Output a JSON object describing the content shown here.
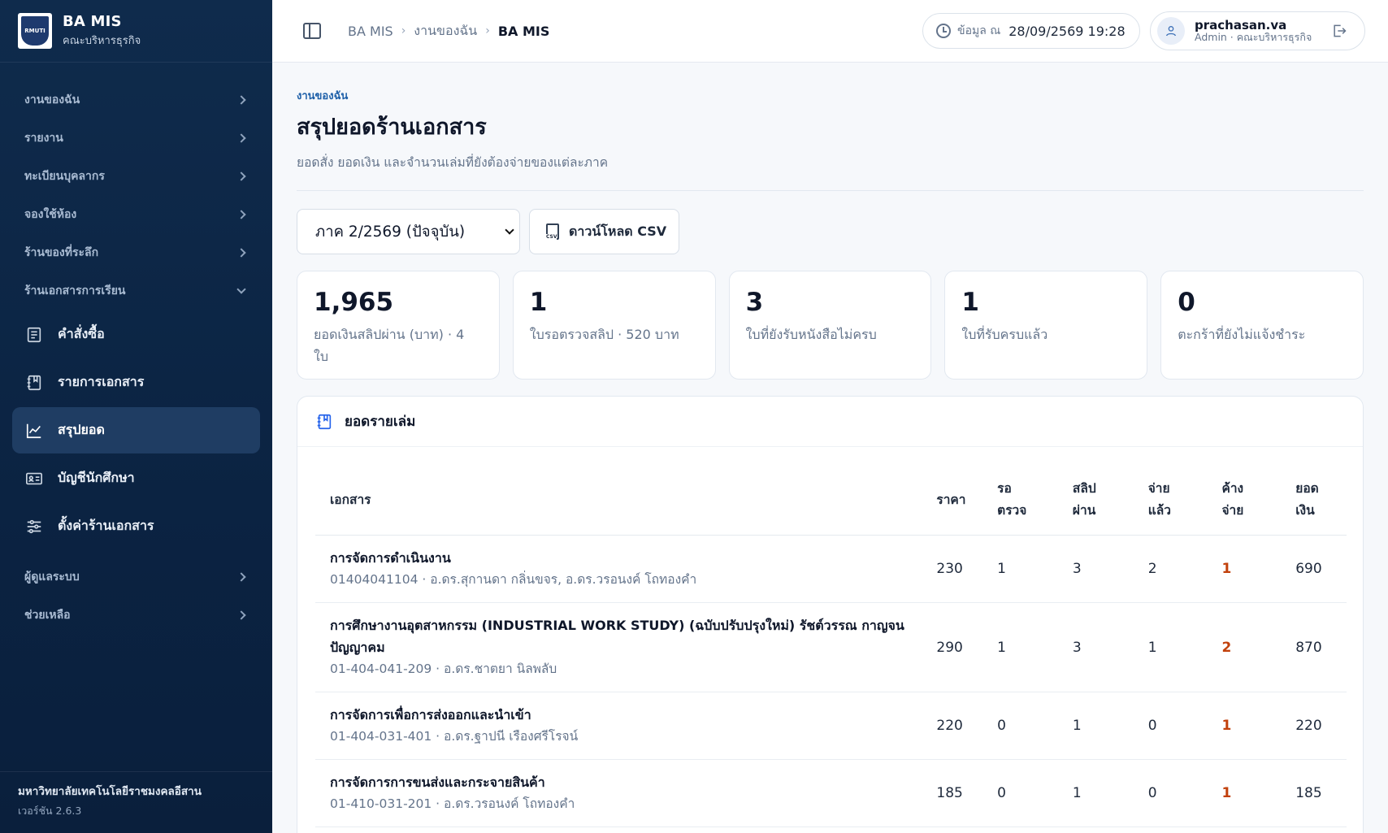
{
  "brand": {
    "title": "BA MIS",
    "subtitle": "คณะบริหารธุรกิจ",
    "logo_text": "RMUTI"
  },
  "sidebar": {
    "groups_top": [
      {
        "label": "งานของฉัน"
      },
      {
        "label": "รายงาน"
      },
      {
        "label": "ทะเบียนบุคลากร"
      },
      {
        "label": "จองใช้ห้อง"
      },
      {
        "label": "ร้านของที่ระลึก"
      },
      {
        "label": "ร้านเอกสารการเรียน"
      }
    ],
    "items": [
      {
        "label": "คำสั่งซื้อ",
        "icon": "receipt-icon"
      },
      {
        "label": "รายการเอกสาร",
        "icon": "book-icon"
      },
      {
        "label": "สรุปยอด",
        "icon": "chart-icon",
        "active": true
      },
      {
        "label": "บัญชีนักศึกษา",
        "icon": "id-card-icon"
      },
      {
        "label": "ตั้งค่าร้านเอกสาร",
        "icon": "sliders-icon"
      }
    ],
    "groups_bottom": [
      {
        "label": "ผู้ดูแลระบบ"
      },
      {
        "label": "ช่วยเหลือ"
      }
    ],
    "footer": {
      "org": "มหาวิทยาลัยเทคโนโลยีราชมงคลอีสาน",
      "version": "เวอร์ชัน 2.6.3"
    }
  },
  "topbar": {
    "breadcrumb": [
      "BA MIS",
      "งานของฉัน",
      "BA MIS"
    ],
    "data_as_of_label": "ข้อมูล ณ",
    "data_as_of_value": "28/09/2569 19:28",
    "user_name": "prachasan.va",
    "user_role": "Admin · คณะบริหารธุรกิจ"
  },
  "page": {
    "eyebrow": "งานของฉัน",
    "title": "สรุปยอดร้านเอกสาร",
    "subtitle": "ยอดสั่ง ยอดเงิน และจำนวนเล่มที่ยังต้องจ่ายของแต่ละภาค"
  },
  "controls": {
    "term_selected": "ภาค 2/2569 (ปัจจุบัน)",
    "download_label": "ดาวน์โหลด CSV",
    "csv_badge": "CSV"
  },
  "stats": [
    {
      "value": "1,965",
      "label": "ยอดเงินสลิปผ่าน (บาท) · 4 ใบ"
    },
    {
      "value": "1",
      "label": "ใบรอตรวจสลิป · 520 บาท"
    },
    {
      "value": "3",
      "label": "ใบที่ยังรับหนังสือไม่ครบ"
    },
    {
      "value": "1",
      "label": "ใบที่รับครบแล้ว"
    },
    {
      "value": "0",
      "label": "ตะกร้าที่ยังไม่แจ้งชำระ"
    }
  ],
  "table": {
    "heading": "ยอดรายเล่ม",
    "columns": [
      "เอกสาร",
      "ราคา",
      "รอ ตรวจ",
      "สลิป ผ่าน",
      "จ่าย แล้ว",
      "ค้าง จ่าย",
      "ยอด เงิน"
    ],
    "rows": [
      {
        "name": "การจัดการดำเนินงาน",
        "meta": "01404041104 · อ.ดร.สุกานดา กลิ่นขจร, อ.ดร.วรอนงค์ โถทองคำ",
        "price": "230",
        "pending": "1",
        "slip_ok": "3",
        "paid": "2",
        "due": "1",
        "amount": "690"
      },
      {
        "name": "การศึกษางานอุตสาหกรรม (INDUSTRIAL WORK STUDY) (ฉบับปรับปรุงใหม่) รัชต์วรรณ กาญจนปัญญาคม",
        "meta": "01-404-041-209 · อ.ดร.ชาตยา นิลพลับ",
        "price": "290",
        "pending": "1",
        "slip_ok": "3",
        "paid": "1",
        "due": "2",
        "amount": "870"
      },
      {
        "name": "การจัดการเพื่อการส่งออกและนำเข้า",
        "meta": "01-404-031-401 · อ.ดร.ฐาปนี เรืองศรีโรจน์",
        "price": "220",
        "pending": "0",
        "slip_ok": "1",
        "paid": "0",
        "due": "1",
        "amount": "220"
      },
      {
        "name": "การจัดการการขนส่งและกระจายสินค้า",
        "meta": "01-410-031-201 · อ.ดร.วรอนงค์ โถทองคำ",
        "price": "185",
        "pending": "0",
        "slip_ok": "1",
        "paid": "0",
        "due": "1",
        "amount": "185"
      }
    ]
  },
  "colors": {
    "sidebar_bg": "#0f2b4c",
    "active_item": "#1f3d63",
    "accent_link": "#1d5fa8",
    "due_highlight": "#c2410c"
  }
}
